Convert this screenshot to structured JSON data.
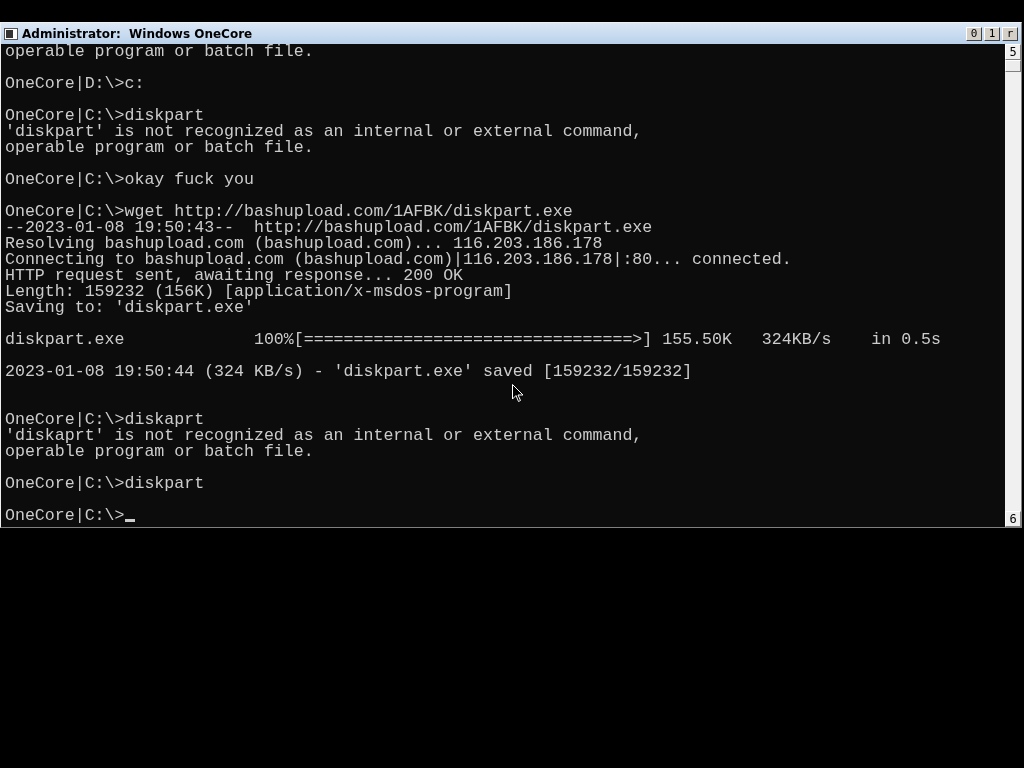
{
  "window": {
    "title": "Administrator:  Windows OneCore",
    "buttons": [
      "0",
      "1",
      "r"
    ]
  },
  "scrollbar": {
    "up": "5",
    "down": "6"
  },
  "console": {
    "blocks": [
      {
        "lines": [
          "operable program or batch file."
        ]
      },
      {
        "lines": [
          "OneCore|D:\\>c:"
        ]
      },
      {
        "lines": [
          "OneCore|C:\\>diskpart",
          "'diskpart' is not recognized as an internal or external command,",
          "operable program or batch file."
        ]
      },
      {
        "lines": [
          "OneCore|C:\\>okay fuck you"
        ]
      },
      {
        "lines": [
          "OneCore|C:\\>wget http://bashupload.com/1AFBK/diskpart.exe",
          "--2023-01-08 19:50:43--  http://bashupload.com/1AFBK/diskpart.exe",
          "Resolving bashupload.com (bashupload.com)... 116.203.186.178",
          "Connecting to bashupload.com (bashupload.com)|116.203.186.178|:80... connected.",
          "HTTP request sent, awaiting response... 200 OK",
          "Length: 159232 (156K) [application/x-msdos-program]",
          "Saving to: 'diskpart.exe'"
        ]
      },
      {
        "lines": [
          "diskpart.exe             100%[=================================>] 155.50K   324KB/s    in 0.5s"
        ]
      },
      {
        "lines": [
          "2023-01-08 19:50:44 (324 KB/s) - 'diskpart.exe' saved [159232/159232]"
        ],
        "extra_gap": true
      },
      {
        "lines": [
          "OneCore|C:\\>diskaprt",
          "'diskaprt' is not recognized as an internal or external command,",
          "operable program or batch file."
        ]
      },
      {
        "lines": [
          "OneCore|C:\\>diskpart"
        ]
      },
      {
        "lines": [
          "OneCore|C:\\>"
        ],
        "cursor": true
      }
    ]
  }
}
